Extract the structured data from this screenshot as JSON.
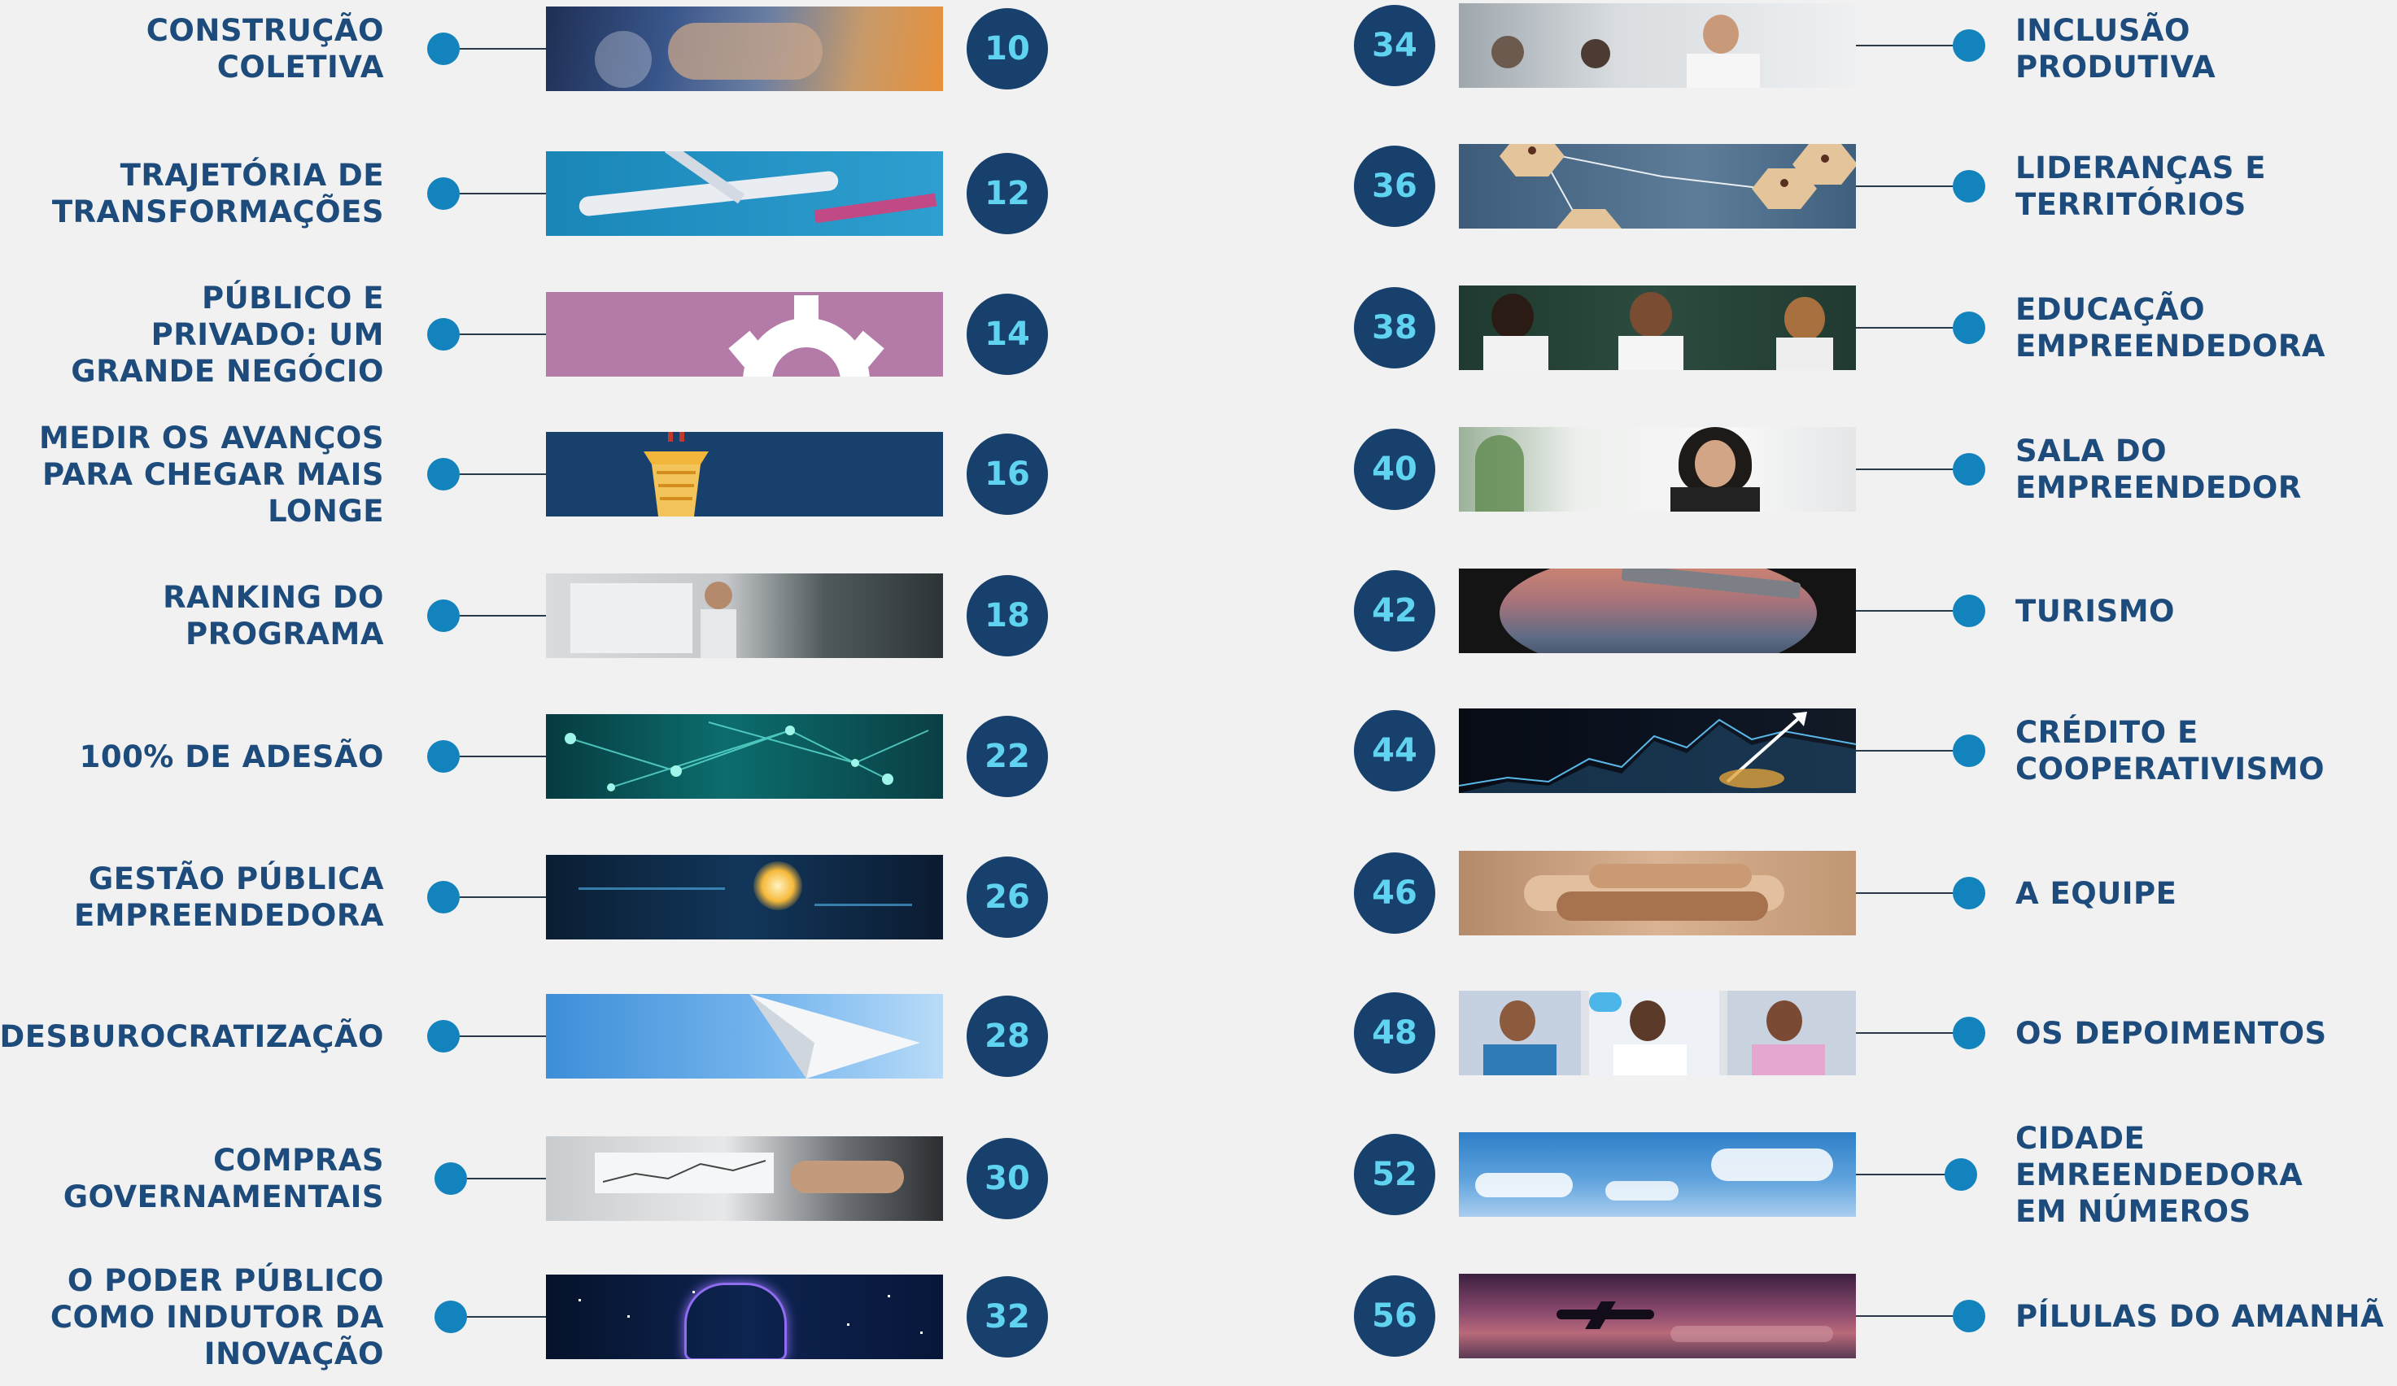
{
  "left_items": [
    {
      "page": "10",
      "lines": [
        "CONSTRUÇÃO",
        "COLETIVA"
      ],
      "image": "handshake-photo"
    },
    {
      "page": "12",
      "lines": [
        "TRAJETÓRIA DE",
        "TRANSFORMAÇÕES"
      ],
      "image": "airplane-photo"
    },
    {
      "page": "14",
      "lines": [
        "PÚBLICO E",
        "PRIVADO: UM",
        "GRANDE NEGÓCIO"
      ],
      "image": "gear-illustration"
    },
    {
      "page": "16",
      "lines": [
        "MEDIR OS AVANÇOS",
        "PARA CHEGAR MAIS",
        "LONGE"
      ],
      "image": "control-tower-illustration"
    },
    {
      "page": "18",
      "lines": [
        "RANKING DO",
        "PROGRAMA"
      ],
      "image": "woman-at-whiteboard-photo"
    },
    {
      "page": "22",
      "lines": [
        "100% DE ADESÃO"
      ],
      "image": "network-technology-image"
    },
    {
      "page": "26",
      "lines": [
        "GESTÃO PÚBLICA",
        "EMPREENDEDORA"
      ],
      "image": "lightbulb-innovation-image"
    },
    {
      "page": "28",
      "lines": [
        "DESBUROCRATIZAÇÃO"
      ],
      "image": "paper-plane-image"
    },
    {
      "page": "30",
      "lines": [
        "COMPRAS",
        "GOVERNAMENTAIS"
      ],
      "image": "laptop-charts-photo"
    },
    {
      "page": "32",
      "lines": [
        "O PODER PÚBLICO",
        "COMO INDUTOR DA",
        "INOVAÇÃO"
      ],
      "image": "digital-hand-image"
    }
  ],
  "right_items": [
    {
      "page": "34",
      "lines": [
        "INCLUSÃO",
        "PRODUTIVA"
      ],
      "image": "office-team-photo"
    },
    {
      "page": "36",
      "lines": [
        "LIDERANÇAS E",
        "TERRITÓRIOS"
      ],
      "image": "hexagon-people-network-image"
    },
    {
      "page": "38",
      "lines": [
        "EDUCAÇÃO",
        "EMPREENDEDORA"
      ],
      "image": "children-classroom-photo"
    },
    {
      "page": "40",
      "lines": [
        "SALA DO",
        "EMPREENDEDOR"
      ],
      "image": "businesswoman-office-photo"
    },
    {
      "page": "42",
      "lines": [
        "TURISMO"
      ],
      "image": "airplane-window-sunset-photo"
    },
    {
      "page": "44",
      "lines": [
        "CRÉDITO E",
        "COOPERATIVISMO"
      ],
      "image": "financial-growth-chart-image"
    },
    {
      "page": "46",
      "lines": [
        "A EQUIPE"
      ],
      "image": "stacked-hands-photo"
    },
    {
      "page": "48",
      "lines": [
        "OS DEPOIMENTOS"
      ],
      "image": "three-people-speech-bubbles-illustration"
    },
    {
      "page": "52",
      "lines": [
        "CIDADE",
        "EMREENDEDORA",
        "EM NÚMEROS"
      ],
      "image": "blue-sky-clouds-photo"
    },
    {
      "page": "56",
      "lines": [
        "PÍLULAS DO AMANHÃ"
      ],
      "image": "airplane-purple-sky-photo"
    }
  ],
  "colors": {
    "background": "#f1f1f2",
    "title_text": "#1d4c7c",
    "dot": "#1283bd",
    "badge_bg": "#17406d",
    "badge_text": "#5fd3f0"
  }
}
